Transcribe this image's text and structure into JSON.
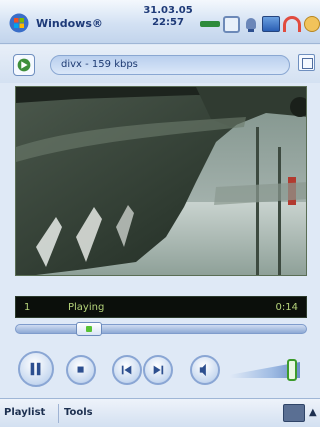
{
  "titlebar": {
    "app_title": "Windows® ",
    "date": "31.03.05",
    "time": "22:57"
  },
  "clipbar": {
    "clip_info": "divx - 159 kbps"
  },
  "status": {
    "track": "1",
    "state": "Playing",
    "elapsed": "0:14"
  },
  "seek": {
    "position": 0.23
  },
  "volume": {
    "level": 0.82
  },
  "menu": {
    "playlist": "Playlist",
    "tools": "Tools",
    "arrow": "▲"
  },
  "icons": {
    "start": "windows-start-icon",
    "signal": "signal-icon",
    "battery": "battery-icon",
    "speaker": "speaker-icon",
    "connectivity": "connectivity-icon",
    "headset": "headset-icon",
    "close": "close-icon",
    "media": "media-player-icon",
    "fullscreen": "fullscreen-icon",
    "keyboard": "keyboard-icon"
  },
  "colors": {
    "status_text": "#b5d37a",
    "accent_green": "#3c9b2b"
  }
}
